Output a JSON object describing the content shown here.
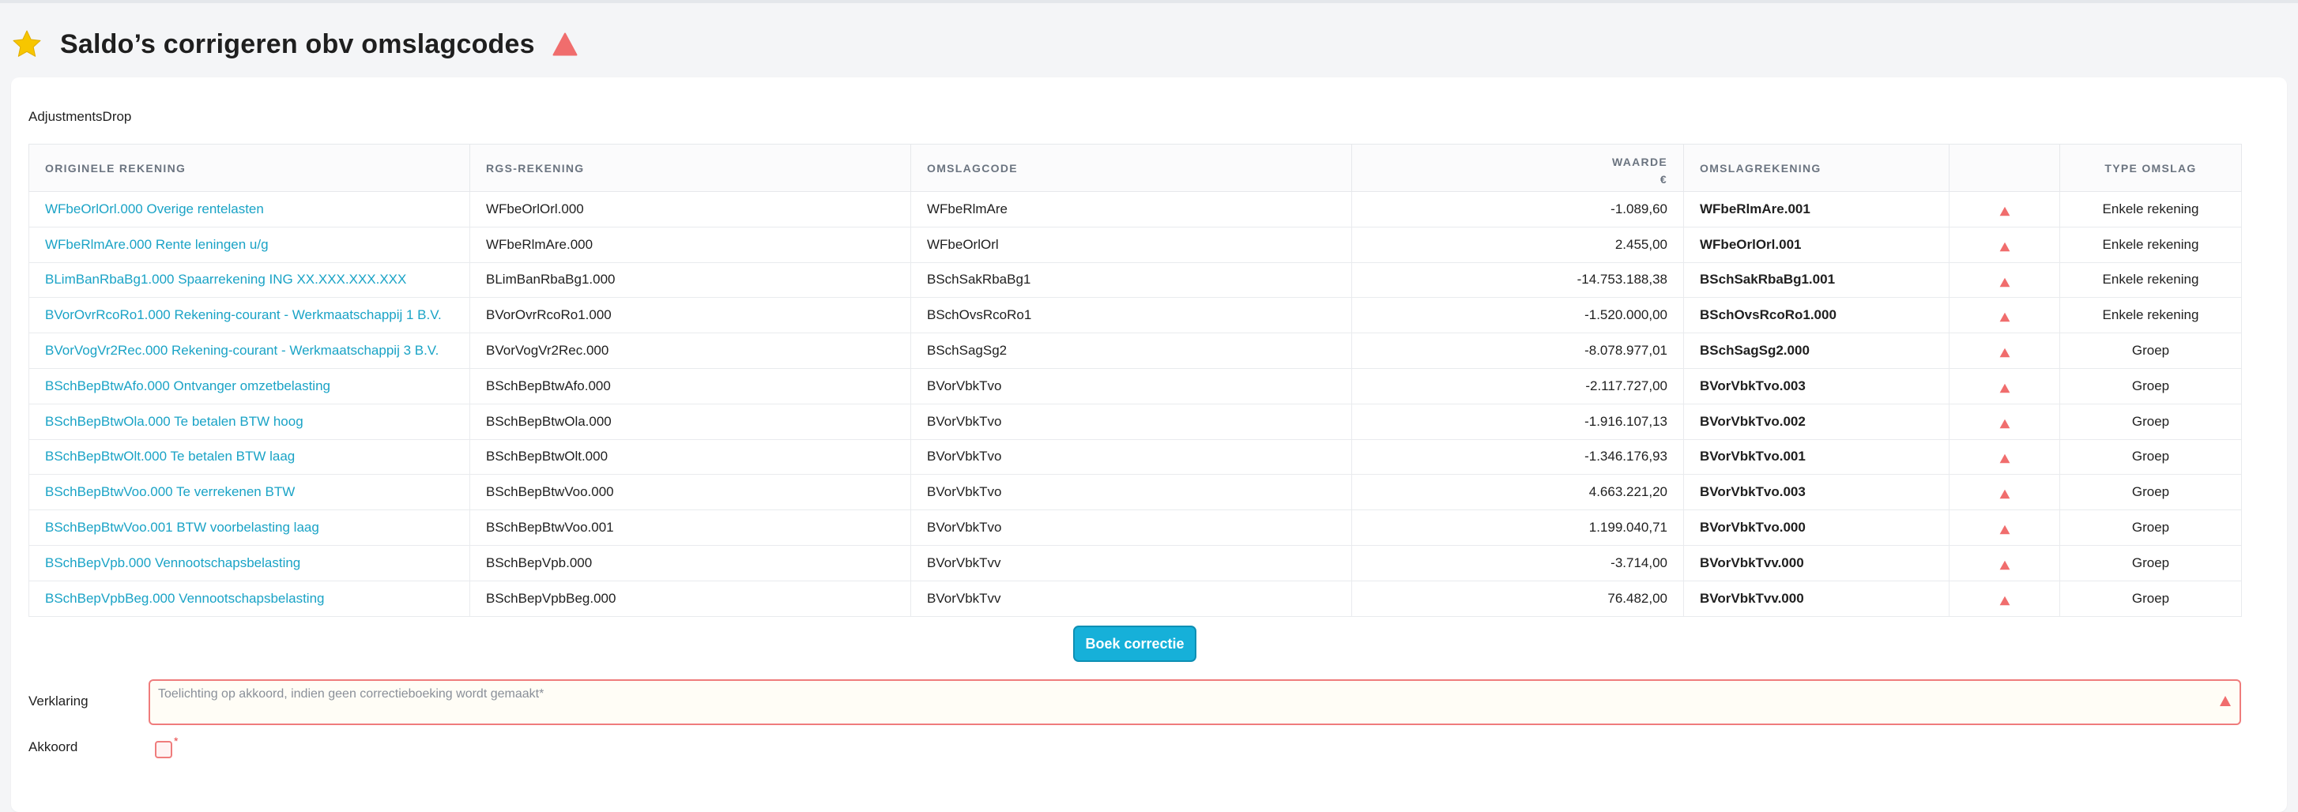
{
  "header": {
    "title": "Saldo’s corrigeren obv omslagcodes",
    "star_icon": "star-icon",
    "warning_icon": "warning-triangle-icon",
    "star_color": "#f7c600",
    "warning_color": "#f06d6d"
  },
  "section": {
    "label": "AdjustmentsDrop"
  },
  "table": {
    "headers": {
      "originele_rekening": "ORIGINELE REKENING",
      "rgs_rekening": "RGS-REKENING",
      "omslagcode": "OMSLAGCODE",
      "waarde": "WAARDE",
      "waarde_unit": "€",
      "omslagrekening": "OMSLAGREKENING",
      "status": "",
      "type_omslag": "TYPE OMSLAG"
    },
    "rows": [
      {
        "originele": "WFbeOrlOrl.000 Overige rentelasten",
        "rgs": "WFbeOrlOrl.000",
        "omslagcode": "WFbeRlmAre",
        "waarde": "-1.089,60",
        "omslagrekening": "WFbeRlmAre.001",
        "type": "Enkele rekening"
      },
      {
        "originele": "WFbeRlmAre.000 Rente leningen u/g",
        "rgs": "WFbeRlmAre.000",
        "omslagcode": "WFbeOrlOrl",
        "waarde": "2.455,00",
        "omslagrekening": "WFbeOrlOrl.001",
        "type": "Enkele rekening"
      },
      {
        "originele": "BLimBanRbaBg1.000 Spaarrekening ING XX.XXX.XXX.XXX",
        "rgs": "BLimBanRbaBg1.000",
        "omslagcode": "BSchSakRbaBg1",
        "waarde": "-14.753.188,38",
        "omslagrekening": "BSchSakRbaBg1.001",
        "type": "Enkele rekening"
      },
      {
        "originele": "BVorOvrRcoRo1.000 Rekening-courant - Werkmaatschappij 1 B.V.",
        "rgs": "BVorOvrRcoRo1.000",
        "omslagcode": "BSchOvsRcoRo1",
        "waarde": "-1.520.000,00",
        "omslagrekening": "BSchOvsRcoRo1.000",
        "type": "Enkele rekening"
      },
      {
        "originele": "BVorVogVr2Rec.000 Rekening-courant - Werkmaatschappij 3 B.V.",
        "rgs": "BVorVogVr2Rec.000",
        "omslagcode": "BSchSagSg2",
        "waarde": "-8.078.977,01",
        "omslagrekening": "BSchSagSg2.000",
        "type": "Groep"
      },
      {
        "originele": "BSchBepBtwAfo.000 Ontvanger omzetbelasting",
        "rgs": "BSchBepBtwAfo.000",
        "omslagcode": "BVorVbkTvo",
        "waarde": "-2.117.727,00",
        "omslagrekening": "BVorVbkTvo.003",
        "type": "Groep"
      },
      {
        "originele": "BSchBepBtwOla.000 Te betalen BTW hoog",
        "rgs": "BSchBepBtwOla.000",
        "omslagcode": "BVorVbkTvo",
        "waarde": "-1.916.107,13",
        "omslagrekening": "BVorVbkTvo.002",
        "type": "Groep"
      },
      {
        "originele": "BSchBepBtwOlt.000 Te betalen BTW laag",
        "rgs": "BSchBepBtwOlt.000",
        "omslagcode": "BVorVbkTvo",
        "waarde": "-1.346.176,93",
        "omslagrekening": "BVorVbkTvo.001",
        "type": "Groep"
      },
      {
        "originele": "BSchBepBtwVoo.000 Te verrekenen BTW",
        "rgs": "BSchBepBtwVoo.000",
        "omslagcode": "BVorVbkTvo",
        "waarde": "4.663.221,20",
        "omslagrekening": "BVorVbkTvo.003",
        "type": "Groep"
      },
      {
        "originele": "BSchBepBtwVoo.001 BTW voorbelasting laag",
        "rgs": "BSchBepBtwVoo.001",
        "omslagcode": "BVorVbkTvo",
        "waarde": "1.199.040,71",
        "omslagrekening": "BVorVbkTvo.000",
        "type": "Groep"
      },
      {
        "originele": "BSchBepVpb.000 Vennootschapsbelasting",
        "rgs": "BSchBepVpb.000",
        "omslagcode": "BVorVbkTvv",
        "waarde": "-3.714,00",
        "omslagrekening": "BVorVbkTvv.000",
        "type": "Groep"
      },
      {
        "originele": "BSchBepVpbBeg.000 Vennootschapsbelasting",
        "rgs": "BSchBepVpbBeg.000",
        "omslagcode": "BVorVbkTvv",
        "waarde": "76.482,00",
        "omslagrekening": "BVorVbkTvv.000",
        "type": "Groep"
      }
    ],
    "row_status_icon": "warning-triangle-icon",
    "link_color": "#1aa3c6"
  },
  "actions": {
    "book_label": "Boek correctie",
    "button_color": "#16b0d9"
  },
  "form": {
    "verklaring_label": "Verklaring",
    "verklaring_placeholder": "Toelichting op akkoord, indien geen correctieboeking wordt gemaakt*",
    "verklaring_value": "",
    "akkoord_label": "Akkoord",
    "akkoord_checked": false,
    "required_mark": "*",
    "error_color": "#ef7c7c"
  }
}
